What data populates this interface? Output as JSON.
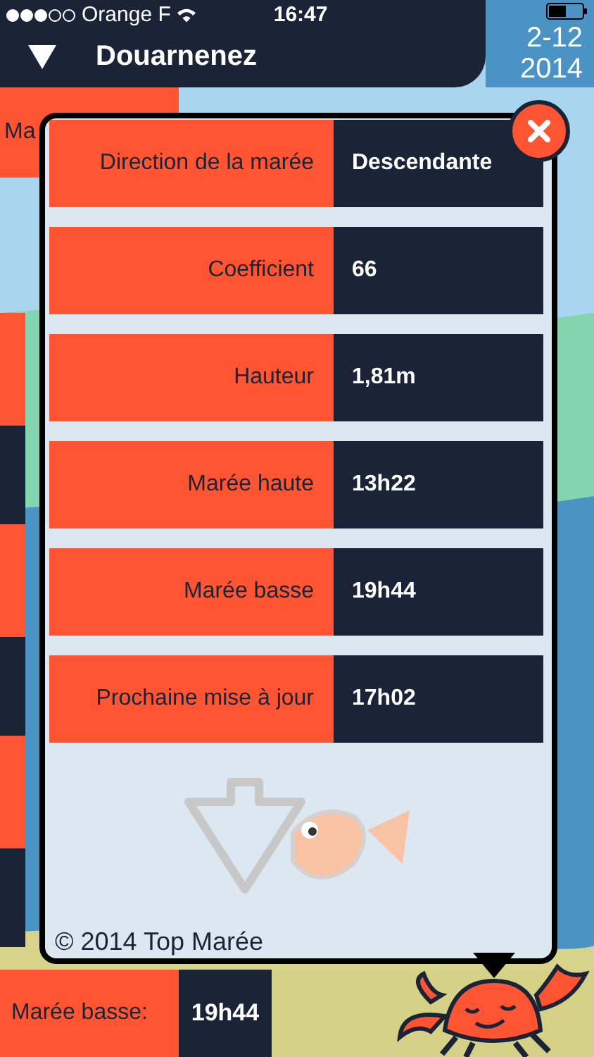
{
  "status_bar": {
    "carrier": "Orange F",
    "time": "16:47"
  },
  "header": {
    "title": "Douarnenez",
    "date_day": "2-12",
    "date_year": "2014"
  },
  "background_label": "Ma",
  "popup": {
    "rows": [
      {
        "label": "Direction de la marée",
        "value": "Descendante"
      },
      {
        "label": "Coefficient",
        "value": "66"
      },
      {
        "label": "Hauteur",
        "value": "1,81m"
      },
      {
        "label": "Marée haute",
        "value": "13h22"
      },
      {
        "label": "Marée basse",
        "value": "19h44"
      },
      {
        "label": "Prochaine mise à jour",
        "value": "17h02"
      }
    ],
    "footer": "© 2014 Top Marée"
  },
  "bottom_bar": {
    "label": "Marée basse:",
    "value": "19h44"
  }
}
